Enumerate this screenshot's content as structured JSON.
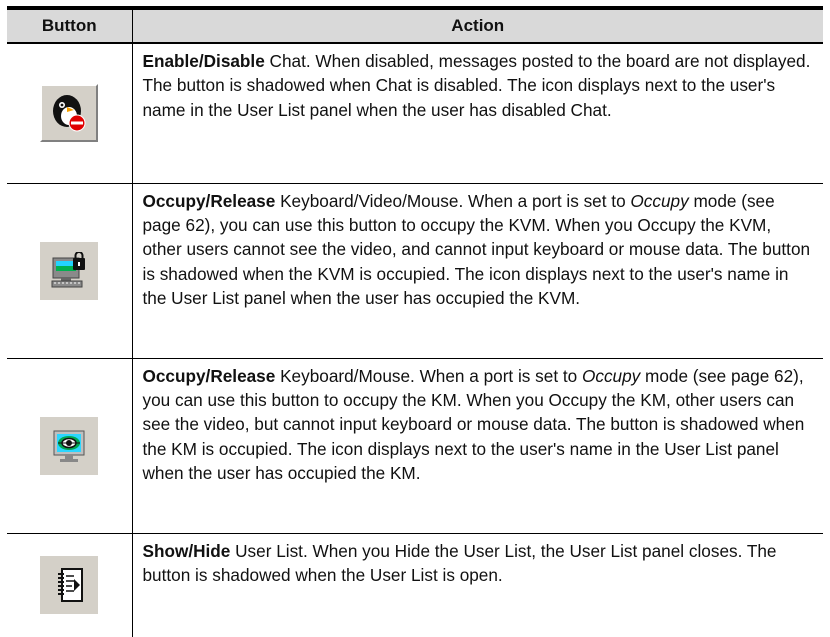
{
  "table": {
    "header_button": "Button",
    "header_action": "Action",
    "rows": [
      {
        "icon": "chat-disable-icon",
        "bold": "Enable/Disable",
        "text_a": " Chat. When disabled, messages posted to the board are not displayed. The button is shadowed when Chat is disabled. The icon displays next to the user's name in the User List panel when the user has disabled Chat.",
        "italic": "",
        "text_b": ""
      },
      {
        "icon": "occupy-kvm-icon",
        "bold": "Occupy/Release",
        "text_a": " Keyboard/Video/Mouse. When a port is set to ",
        "italic": "Occupy",
        "text_b": " mode (see page 62), you can use this button to occupy the KVM. When you Occupy the KVM, other users cannot see the video, and cannot input keyboard or mouse data. The button is shadowed when the KVM is occupied. The icon displays next to the user's name in the User List panel when the user has occupied the KVM."
      },
      {
        "icon": "occupy-km-icon",
        "bold": "Occupy/Release",
        "text_a": " Keyboard/Mouse. When a port is set to ",
        "italic": "Occupy",
        "text_b": " mode (see page 62), you can use this button to occupy the KM. When you Occupy the KM, other users can see the video, but cannot input keyboard or mouse data. The button is shadowed when the KM is occupied. The icon displays next to the user's name in the User List panel when the user has occupied the KM."
      },
      {
        "icon": "user-list-icon",
        "bold": "Show/Hide",
        "text_a": " User List. When you Hide the User List, the User List panel closes. The button is shadowed when the User List is open.",
        "italic": "",
        "text_b": ""
      }
    ]
  },
  "colors": {
    "header_bg": "#d9d9d9",
    "button_face": "#d4d0c8"
  }
}
